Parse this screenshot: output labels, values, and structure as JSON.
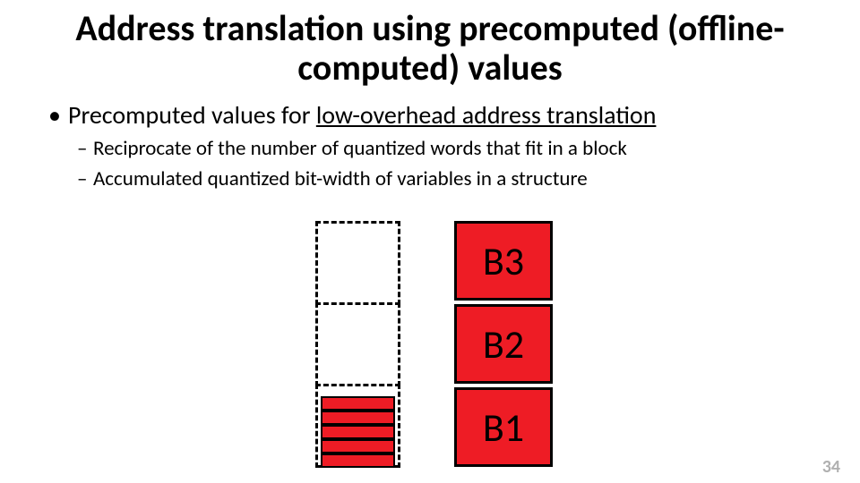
{
  "title": "Address translation using precomputed (offline-computed) values",
  "bullet1_pre": "Precomputed values  for ",
  "bullet1_underline": "low-overhead address translation",
  "sub1": "Reciprocate of the number of quantized words that fit in a block",
  "sub2": "Accumulated quantized bit-width of variables in a structure",
  "blocks": {
    "b3": "B3",
    "b2": "B2",
    "b1": "B1"
  },
  "page_number": "34"
}
